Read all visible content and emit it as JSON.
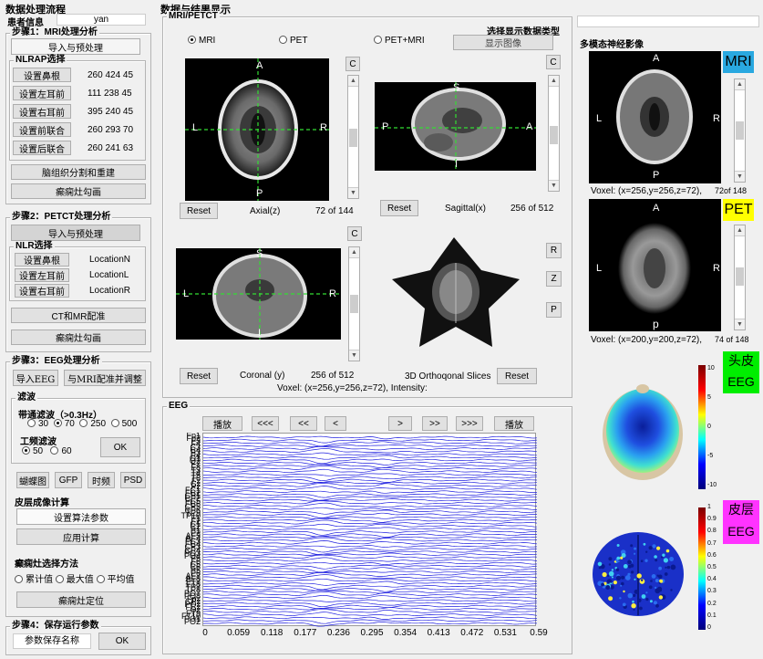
{
  "left": {
    "title": "数据处理流程",
    "patient_label": "患者信息",
    "patient_value": "yan",
    "step1": "步骤1：MRI处理分析",
    "import_preview": "导入与预处理",
    "nlrap": "NLRAP选择",
    "fid_buttons": [
      "设置鼻根",
      "设置左耳前",
      "设置右耳前",
      "设置前联合",
      "设置后联合"
    ],
    "fid_values": [
      "260 424 45",
      "111 238 45",
      "395 240 45",
      "260 293 70",
      "260 241 63"
    ],
    "brain_seg": "脑组织分割和重建",
    "epi_outline": "癫痫灶勾画",
    "step2": "步骤2：PETCT处理分析",
    "nlr": "NLR选择",
    "nlr_buttons": [
      "设置鼻根",
      "设置左耳前",
      "设置右耳前"
    ],
    "nlr_values": [
      "LocationN",
      "LocationL",
      "LocationR"
    ],
    "ct_mr": "CT和MR配准",
    "epi_outline2": "癫痫灶勾画",
    "step3": "步骤3：EEG处理分析",
    "import_eeg": "导入EEG",
    "eeg_mri_reg": "与MRI配准并调整",
    "filter": "滤波",
    "bandpass": "带通滤波（>0.3Hz）",
    "band_opts": [
      "30",
      "70",
      "250",
      "500"
    ],
    "notch": "工频滤波",
    "notch_opts": [
      "50",
      "60"
    ],
    "ok": "OK",
    "tools": [
      "蝴蝶图",
      "GFP",
      "时频",
      "PSD"
    ],
    "cortex_calc": "皮层成像计算",
    "set_params": "设置算法参数",
    "apply_calc": "应用计算",
    "epi_method": "癫痫灶选择方法",
    "method_opts": [
      "累计值",
      "最大值",
      "平均值"
    ],
    "locate": "癫痫灶定位",
    "step4": "步骤4：保存运行参数",
    "param_name": "参数保存名称",
    "ok2": "OK"
  },
  "middle": {
    "title": "数据与结果显示",
    "mri_petct": "MRI/PETCT",
    "view_opts": [
      "MRI",
      "PET",
      "PET+MRI"
    ],
    "select_type": "选择显示数据类型",
    "show_image": "显示图像",
    "c": "C",
    "reset": "Reset",
    "axial": "Axial(z)",
    "axial_count": "72 of 144",
    "sagittal": "Sagittal(x)",
    "sagittal_count": "256 of 512",
    "coronal": "Coronal (y)",
    "coronal_count": "256 of 512",
    "ortho": "3D Orthoqonal Slices",
    "voxel_info": "Voxel: (x=256,y=256,z=72), Intensity:",
    "rzp": [
      "R",
      "Z",
      "P"
    ],
    "ax_letters": {
      "a": "A",
      "l": "L",
      "r": "R",
      "p": "P"
    },
    "sag_letters": {
      "s": "S",
      "p": "P",
      "a": "A",
      "i": "I"
    },
    "cor_letters": {
      "s": "S",
      "l": "L",
      "r": "R",
      "i": "I"
    },
    "eeg": "EEG",
    "play": "播放",
    "nav": [
      "<<<",
      "<<",
      "<",
      ">",
      ">>",
      ">>>"
    ],
    "pause": "播放",
    "channels": [
      "Fp1",
      "Fp2",
      "F3",
      "F4",
      "C3",
      "C4",
      "P3",
      "P4",
      "O1",
      "O2",
      "F7",
      "F8",
      "T3",
      "T4",
      "T5",
      "T6",
      "Fz",
      "Cz",
      "Pz",
      "FC1",
      "FC2",
      "CP1",
      "CP2",
      "FC5",
      "FC6",
      "CP5",
      "CP6",
      "TP9",
      "TP10",
      "F1",
      "F2",
      "C1",
      "C2",
      "P1",
      "P2",
      "AF3",
      "AF4",
      "FC3",
      "FC4",
      "CP3",
      "CP4",
      "PO3",
      "PO4",
      "F5",
      "F6",
      "C5",
      "C6",
      "P5",
      "P6",
      "AF7",
      "AF8",
      "FT7",
      "FT8",
      "TP7",
      "TP8",
      "PO7",
      "PO8",
      "Fpz",
      "CPz",
      "POz",
      "FCz",
      "Oz",
      "FT9",
      "FT10",
      "PO1",
      "PO2"
    ],
    "xticks": [
      "0",
      "0.059",
      "0.118",
      "0.177",
      "0.236",
      "0.295",
      "0.354",
      "0.413",
      "0.472",
      "0.531",
      "0.59"
    ]
  },
  "right": {
    "title": "多模态神经影像",
    "mri_badge": "MRI",
    "pet_badge": "PET",
    "mri_voxel": "Voxel: (x=256,y=256,z=72),",
    "mri_count": "72of 148",
    "pet_voxel": "Voxel: (x=200,y=200,z=72),",
    "pet_count": "74 of 148",
    "mri_letters": {
      "a": "A",
      "l": "L",
      "r": "R",
      "p": "P"
    },
    "pet_letters": {
      "a": "A",
      "l": "L",
      "r": "R",
      "p": "p"
    },
    "scalp1": "头皮",
    "scalp2": "EEG",
    "cortex1": "皮层",
    "cortex2": "EEG",
    "cb1_ticks": [
      "10",
      "5",
      "0",
      "-5",
      "-10"
    ],
    "cb2_ticks": [
      "1",
      "0.9",
      "0.8",
      "0.7",
      "0.6",
      "0.5",
      "0.4",
      "0.3",
      "0.2",
      "0.1",
      "0"
    ],
    "colors": {
      "mri_badge": "#29a8e0",
      "pet_badge": "#ffff00",
      "scalp_badge": "#00ee00",
      "cortex_badge": "#ff33ff"
    }
  }
}
